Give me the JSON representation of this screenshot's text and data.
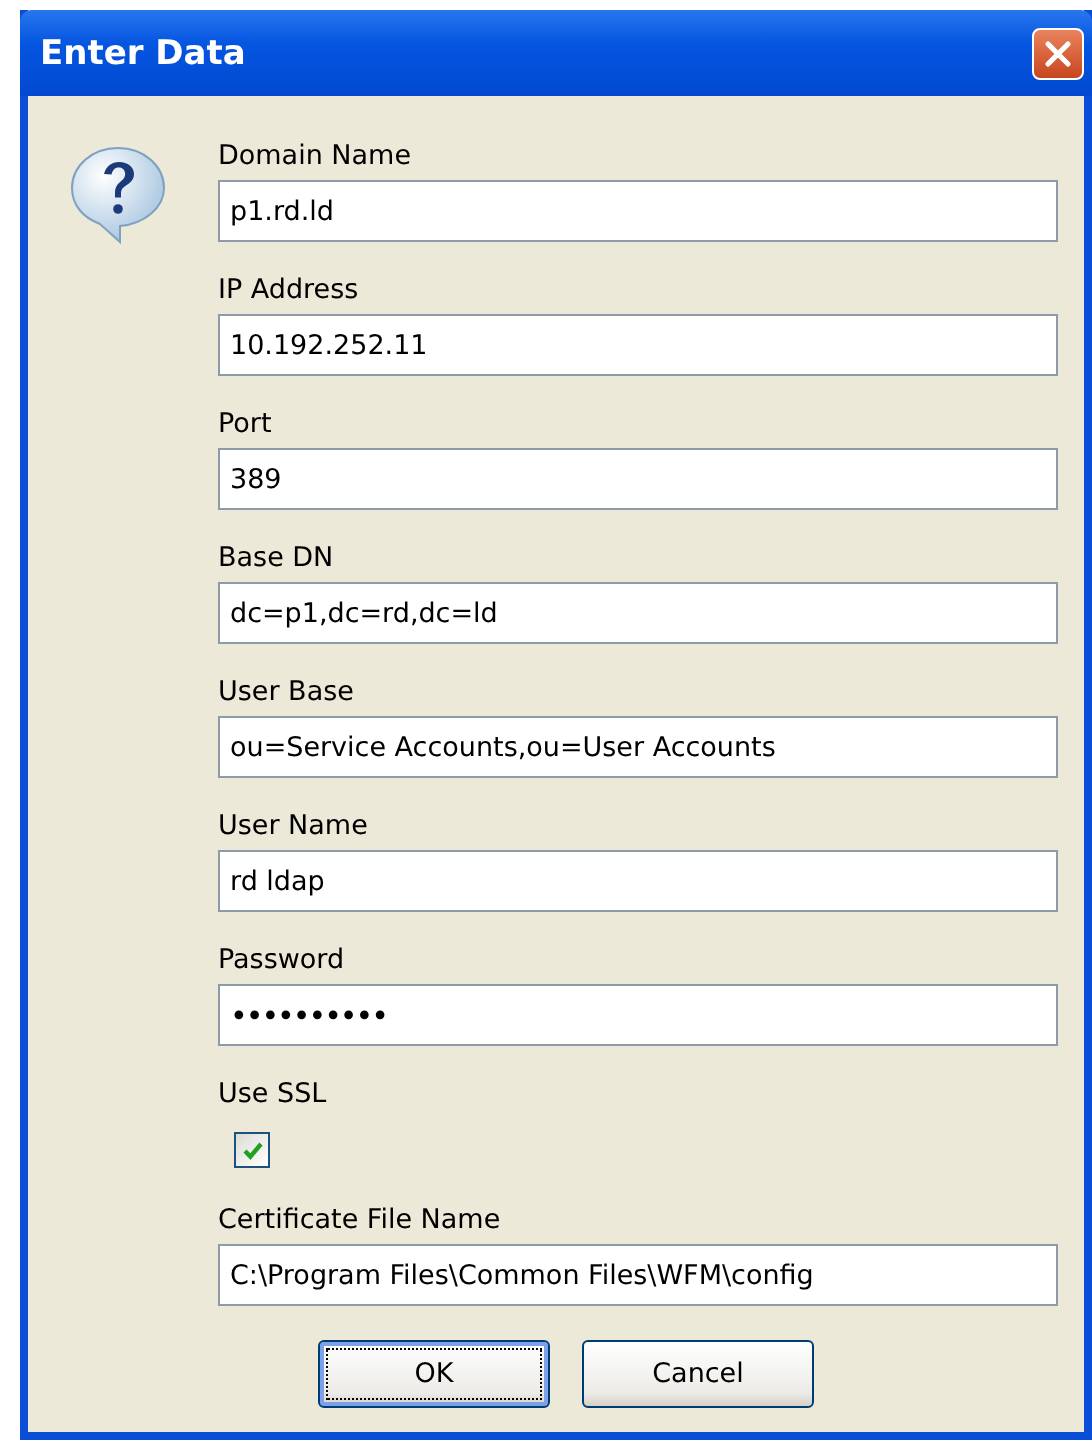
{
  "window": {
    "title": "Enter Data"
  },
  "fields": [
    {
      "kind": "text",
      "label": "Domain Name",
      "value": "p1.rd.ld"
    },
    {
      "kind": "text",
      "label": "IP Address",
      "value": "10.192.252.11"
    },
    {
      "kind": "text",
      "label": "Port",
      "value": "389"
    },
    {
      "kind": "text",
      "label": "Base DN",
      "value": "dc=p1,dc=rd,dc=ld"
    },
    {
      "kind": "text",
      "label": "User Base",
      "value": "ou=Service Accounts,ou=User Accounts"
    },
    {
      "kind": "text",
      "label": "User Name",
      "value": "rd ldap"
    },
    {
      "kind": "password",
      "label": "Password",
      "value": "••••••••••"
    },
    {
      "kind": "checkbox",
      "label": "Use SSL",
      "checked": true
    },
    {
      "kind": "text",
      "label": "Certificate File Name",
      "value": "C:\\Program Files\\Common Files\\WFM\\config"
    }
  ],
  "buttons": [
    {
      "label": "OK",
      "selected": true
    },
    {
      "label": "Cancel",
      "selected": false
    }
  ]
}
